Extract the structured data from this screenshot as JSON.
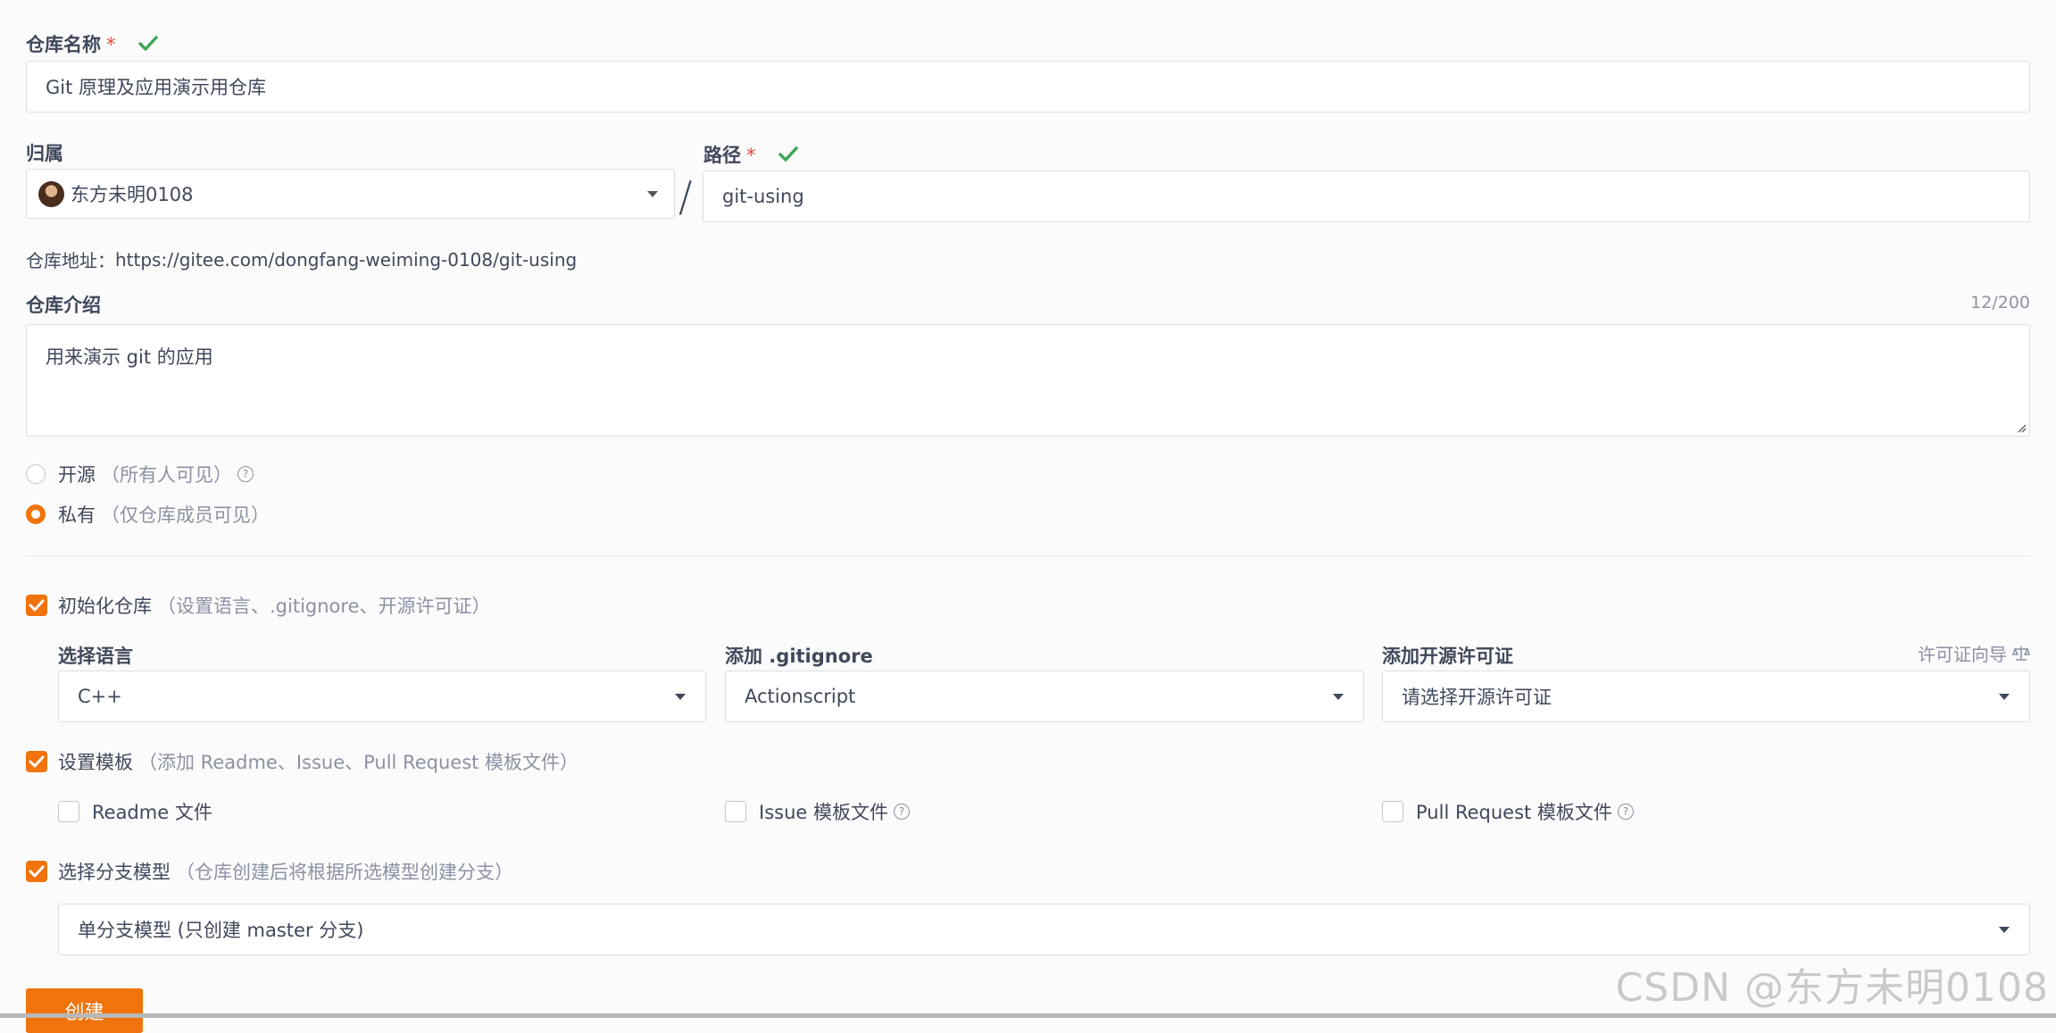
{
  "repo_name": {
    "label": "仓库名称",
    "required_mark": "*",
    "value": "Git 原理及应用演示用仓库"
  },
  "owner": {
    "label": "归属",
    "value": "东方未明0108"
  },
  "slash": "/",
  "path": {
    "label": "路径",
    "required_mark": "*",
    "value": "git-using"
  },
  "repo_url": {
    "label": "仓库地址：",
    "value": "https://gitee.com/dongfang-weiming-0108/git-using"
  },
  "description": {
    "label": "仓库介绍",
    "counter": "12/200",
    "value": "用来演示 git 的应用"
  },
  "visibility": {
    "public": {
      "label": "开源",
      "hint": "（所有人可见）",
      "selected": false
    },
    "private": {
      "label": "私有",
      "hint": "（仅仓库成员可见）",
      "selected": true
    }
  },
  "init_repo": {
    "label": "初始化仓库",
    "hint": "（设置语言、.gitignore、开源许可证）",
    "checked": true
  },
  "language": {
    "label": "选择语言",
    "value": "C++"
  },
  "gitignore": {
    "label": "添加 .gitignore",
    "value": "Actionscript"
  },
  "license": {
    "label": "添加开源许可证",
    "guide": "许可证向导",
    "placeholder": "请选择开源许可证"
  },
  "template": {
    "label": "设置模板",
    "hint": "（添加 Readme、Issue、Pull Request 模板文件）",
    "checked": true
  },
  "template_files": {
    "readme": {
      "label": "Readme 文件",
      "checked": false
    },
    "issue": {
      "label": "Issue 模板文件",
      "checked": false
    },
    "pull_request": {
      "label": "Pull Request 模板文件",
      "checked": false
    }
  },
  "branch_model": {
    "label": "选择分支模型",
    "hint": "（仓库创建后将根据所选模型创建分支）",
    "checked": true,
    "value": "单分支模型 (只创建 master 分支)"
  },
  "create_button": {
    "label": "创建"
  },
  "watermark": "CSDN @东方未明0108",
  "colors": {
    "accent": "#f0730c",
    "success": "#3fa65a",
    "required": "#e5463e"
  },
  "icons": [
    "check-icon",
    "chevron-down-icon",
    "question-circle-icon",
    "scale-icon",
    "avatar"
  ]
}
